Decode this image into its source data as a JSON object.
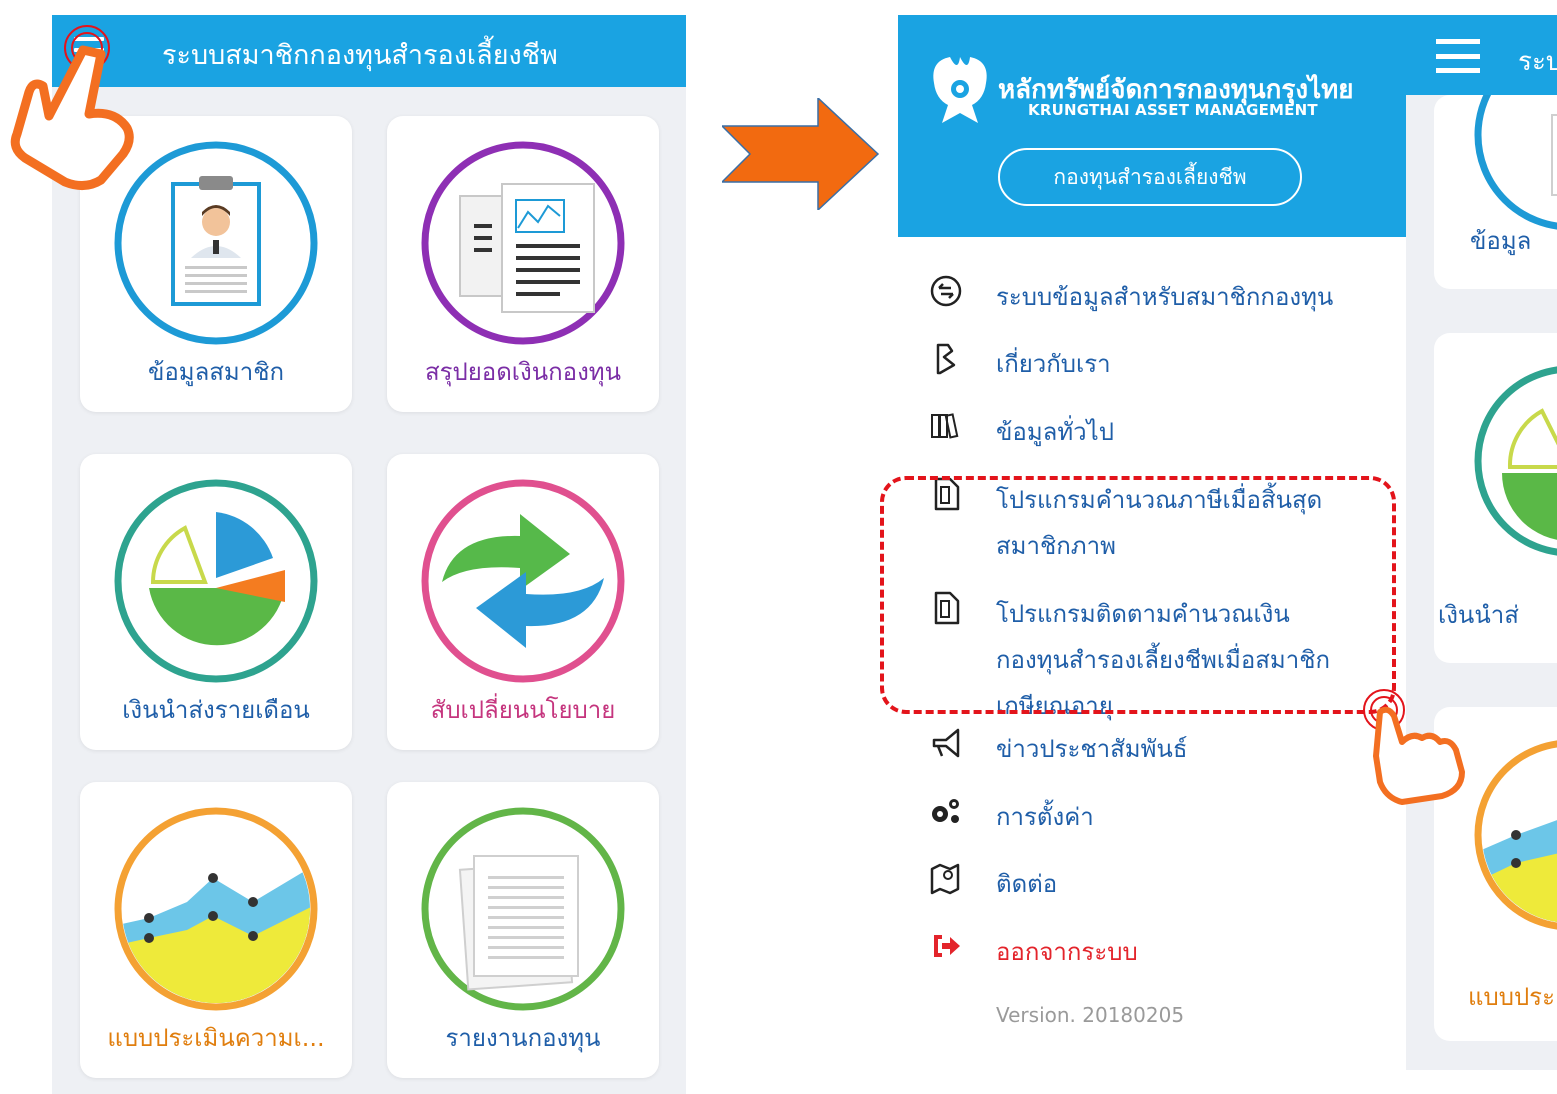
{
  "left_screen": {
    "header_title": "ระบบสมาชิกกองทุนสำรองเลี้ยงชีพ",
    "cards": [
      {
        "label": "ข้อมูลสมาชิก",
        "icon": "member-clipboard-icon",
        "ring": "#1d9ad6",
        "label_color": "#1f5ea8"
      },
      {
        "label": "สรุปยอดเงินกองทุน",
        "icon": "fund-summary-document-icon",
        "ring": "#8e2fb4",
        "label_color": "#7b2ea6"
      },
      {
        "label": "เงินนำส่งรายเดือน",
        "icon": "pie-chart-icon",
        "ring": "#2ea38f",
        "label_color": "#1f5ea8"
      },
      {
        "label": "สับเปลี่ยนนโยบาย",
        "icon": "switch-policy-arrows-icon",
        "ring": "#e0508f",
        "label_color": "#c5357e"
      },
      {
        "label": "แบบประเมินความเ...",
        "icon": "assessment-area-chart-icon",
        "ring": "#f4a133",
        "label_color": "#e07e0e"
      },
      {
        "label": "รายงานกองทุน",
        "icon": "fund-report-icon",
        "ring": "#62b548",
        "label_color": "#1f5ea8"
      }
    ]
  },
  "drawer": {
    "brand_th": "หลักทรัพย์จัดการกองทุนกรุงไทย",
    "brand_en": "KRUNGTHAI ASSET MANAGEMENT",
    "fund_button": "กองทุนสำรองเลี้ยงชีพ",
    "menu": [
      {
        "icon": "member-info-icon",
        "lines": [
          "ระบบข้อมูลสำหรับสมาชิกกองทุน"
        ]
      },
      {
        "icon": "about-us-icon",
        "lines": [
          "เกี่ยวกับเรา"
        ]
      },
      {
        "icon": "general-info-icon",
        "lines": [
          "ข้อมูลทั่วไป"
        ]
      },
      {
        "icon": "tax-calculator-document-icon",
        "lines": [
          "โปรแกรมคำนวณภาษีเมื่อสิ้นสุด",
          "สมาชิกภาพ"
        ]
      },
      {
        "icon": "retirement-calculator-document-icon",
        "lines": [
          "โปรแกรมติดตามคำนวณเงิน",
          "กองทุนสำรองเลี้ยงชีพเมื่อสมาชิก",
          "เกษียณอายุ"
        ]
      },
      {
        "icon": "megaphone-icon",
        "lines": [
          "ข่าวประชาสัมพันธ์"
        ]
      },
      {
        "icon": "gears-icon",
        "lines": [
          "การตั้งค่า"
        ]
      },
      {
        "icon": "contact-map-icon",
        "lines": [
          "ติดต่อ"
        ]
      },
      {
        "icon": "logout-icon",
        "lines": [
          "ออกจากระบบ"
        ],
        "color": "#e3242b"
      }
    ],
    "version": "Version. 20180205"
  },
  "right_screen_partial": {
    "header_title": "ระบ",
    "card_labels": [
      "ข้อมูล",
      "เงินนำส่",
      "แบบประ"
    ]
  }
}
